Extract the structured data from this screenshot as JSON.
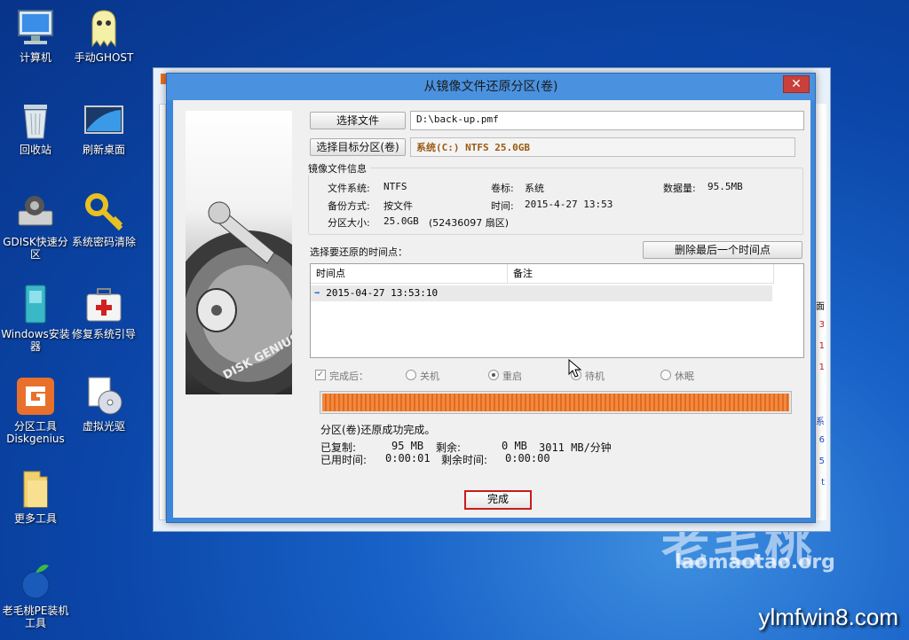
{
  "desktop": {
    "icons": [
      {
        "label": "计算机"
      },
      {
        "label": "手动GHOST"
      },
      {
        "label": "回收站"
      },
      {
        "label": "刷新桌面"
      },
      {
        "label": "GDISK快速分区"
      },
      {
        "label": "系统密码清除"
      },
      {
        "label": "Windows安装器"
      },
      {
        "label": "修复系统引导"
      },
      {
        "label": "分区工具Diskgenius"
      },
      {
        "label": "虚拟光驱"
      },
      {
        "label": "更多工具"
      },
      {
        "label": "老毛桃PE装机工具"
      }
    ],
    "watermark_logo": "老毛桃",
    "watermark_site": "laomaotao.org",
    "corner_site": "ylmfwin8.com"
  },
  "background_window": {
    "right_strip_chars": [
      "面",
      "3",
      "1",
      "1",
      "系",
      "6",
      "5",
      "t"
    ]
  },
  "dialog": {
    "title": "从镜像文件还原分区(卷)",
    "close_glyph": "✕",
    "image_brand": "DISK GENIUS",
    "choose_file_label": "选择文件",
    "file_path": "D:\\back-up.pmf",
    "choose_target_label": "选择目标分区(卷)",
    "target_value": "系统(C:) NTFS 25.0GB",
    "info_group_label": "镜像文件信息",
    "info": {
      "fs_label": "文件系统:",
      "fs_value": "NTFS",
      "volume_label": "卷标:",
      "volume_value": "系统",
      "data_label": "数据量:",
      "data_value": "95.5MB",
      "mode_label": "备份方式:",
      "mode_value": "按文件",
      "time_label": "时间:",
      "time_value": "2015-4-27 13:53",
      "size_label": "分区大小:",
      "size_value": "25.0GB",
      "sectors_value": "(52436097 扇区)"
    },
    "restore_point_label": "选择要还原的时间点：",
    "delete_last_label": "删除最后一个时间点",
    "list": {
      "col_time": "时间点",
      "col_note": "备注",
      "rows": [
        {
          "time": "2015-04-27 13:53:10",
          "note": ""
        }
      ]
    },
    "after_label": "完成后：",
    "options": [
      "关机",
      "重启",
      "待机",
      "休眠"
    ],
    "selected_option": "重启",
    "progress_fraction": 1.0,
    "status_text": "分区(卷)还原成功完成。",
    "stats": {
      "copied_label": "已复制:",
      "copied_value": "95 MB",
      "remain_label": "剩余:",
      "remain_value": "0 MB",
      "speed_value": "3011 MB/分钟",
      "elapsed_label": "已用时间:",
      "elapsed_value": "0:00:01",
      "left_label": "剩余时间:",
      "left_value": "0:00:00"
    },
    "done_label": "完成"
  }
}
